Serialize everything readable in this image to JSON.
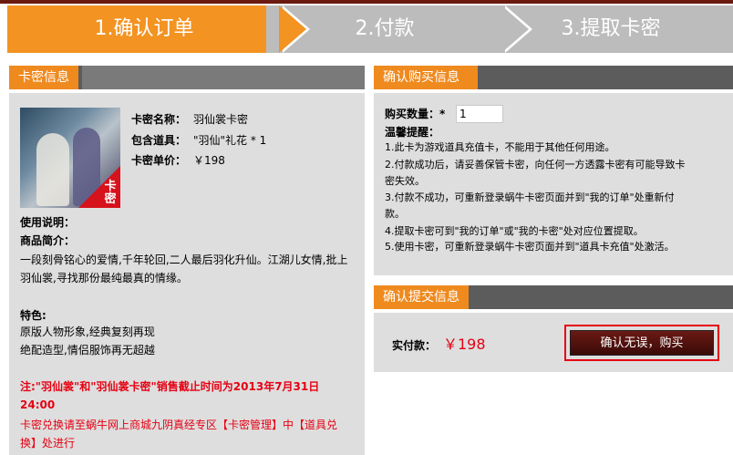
{
  "steps": [
    {
      "label": "1.确认订单",
      "active": true
    },
    {
      "label": "2.付款",
      "active": false
    },
    {
      "label": "3.提取卡密",
      "active": false
    }
  ],
  "left_panel": {
    "title": "卡密信息",
    "corner_badge": "卡密",
    "card_name_label": "卡密名称：",
    "card_name": "羽仙裳卡密",
    "contents_label": "包含道具：",
    "contents": "\"羽仙\"礼花 * 1",
    "price_label": "卡密单价：",
    "price": "￥198",
    "usage_label": "使用说明：",
    "intro_label": "商品简介：",
    "intro_line1": "一段刻骨铭心的爱情,千年轮回,二人最后羽化升仙。江湖儿女情,批上",
    "intro_line2": "羽仙裳,寻找那份最纯最真的情缘。",
    "feature_label": "特色:",
    "feature_line1": "原版人物形象,经典复刻再现",
    "feature_line2": "绝配造型,情侣服饰再无超越",
    "notice_line1": "注:\"羽仙裳\"和\"羽仙裳卡密\"销售截止时间为2013年7月31日",
    "notice_line2": "24:00",
    "redeem_line1": "卡密兑换请至蜗牛网上商城九阴真经专区【卡密管理】中【道具兑",
    "redeem_line2": "换】处进行"
  },
  "right_panel": {
    "title": "确认购买信息",
    "qty_label": "购买数量：*",
    "qty_value": "1",
    "tips_label": "温馨提醒：",
    "tips": [
      "1.此卡为游戏道具充值卡，不能用于其他任何用途。",
      "2.付款成功后，请妥善保管卡密，向任何一方透露卡密有可能导致卡",
      "密失效。",
      "3.付款不成功，可重新登录蜗牛卡密页面并到\"我的订单\"处重新付",
      "款。",
      "4.提取卡密可到\"我的订单\"或\"我的卡密\"处对应位置提取。",
      "5.使用卡密，可重新登录蜗牛卡密页面并到\"道具卡充值\"处激活。"
    ]
  },
  "submit_panel": {
    "title": "确认提交信息",
    "pay_label": "实付款：",
    "pay_amount": "￥198",
    "confirm_button": "确认无误，购买"
  },
  "colors": {
    "accent": "#f39322",
    "header_dark": "#5c5c5c",
    "alert_red": "#e60012"
  }
}
